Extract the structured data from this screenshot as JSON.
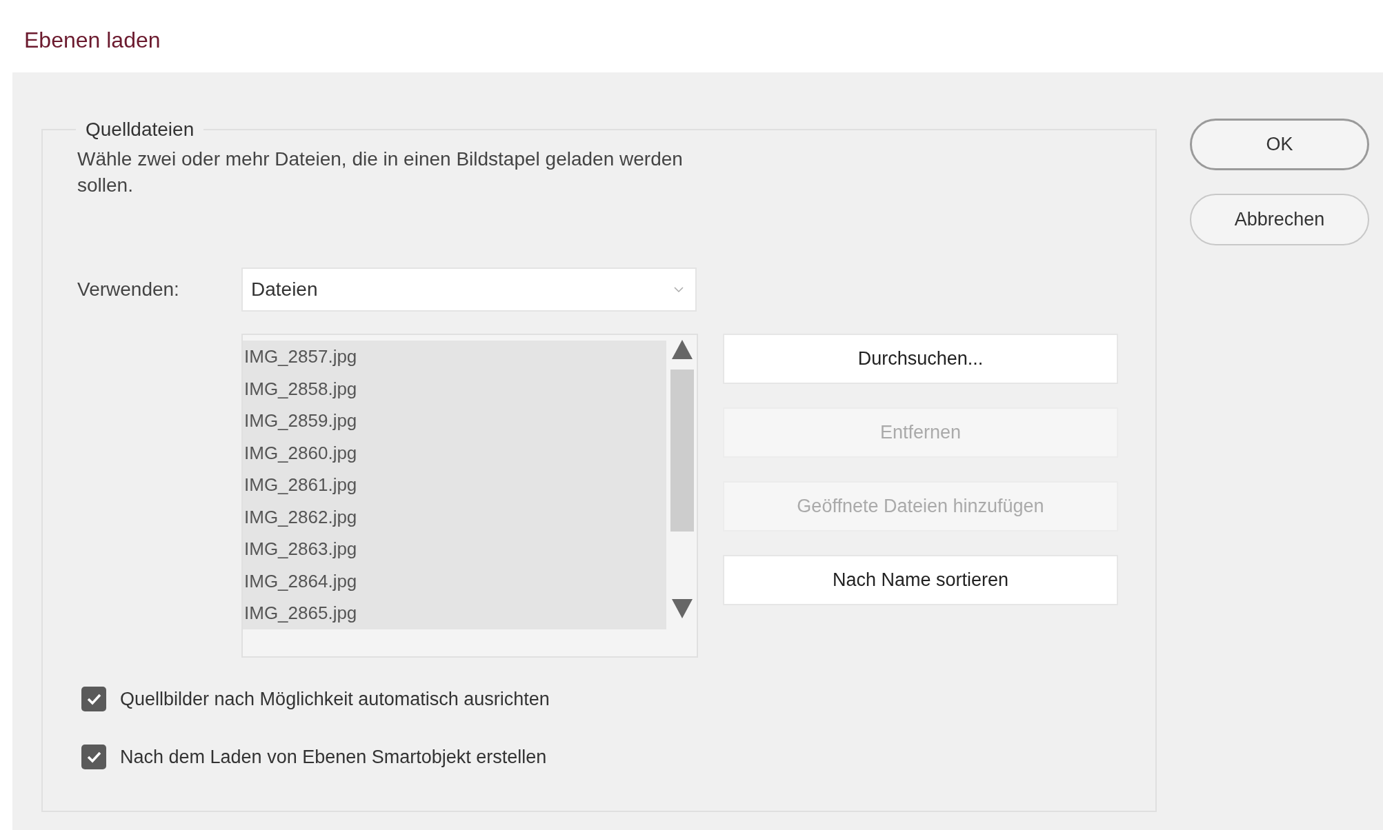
{
  "window": {
    "title": "Ebenen laden"
  },
  "source_files": {
    "legend": "Quelldateien",
    "description": "Wähle zwei oder mehr Dateien, die in einen Bildstapel geladen werden sollen.",
    "use": {
      "label": "Verwenden:",
      "value": "Dateien"
    },
    "files": [
      {
        "name": "IMG_2857.jpg",
        "selected": true
      },
      {
        "name": "IMG_2858.jpg",
        "selected": true
      },
      {
        "name": "IMG_2859.jpg",
        "selected": true
      },
      {
        "name": "IMG_2860.jpg",
        "selected": true
      },
      {
        "name": "IMG_2861.jpg",
        "selected": true
      },
      {
        "name": "IMG_2862.jpg",
        "selected": true
      },
      {
        "name": "IMG_2863.jpg",
        "selected": true
      },
      {
        "name": "IMG_2864.jpg",
        "selected": true
      },
      {
        "name": "IMG_2865.jpg",
        "selected": true
      }
    ],
    "buttons": [
      {
        "label": "Durchsuchen...",
        "disabled": false
      },
      {
        "label": "Entfernen",
        "disabled": true
      },
      {
        "label": "Geöffnete Dateien hinzufügen",
        "disabled": true
      },
      {
        "label": "Nach Name sortieren",
        "disabled": false
      }
    ],
    "options": [
      {
        "label": "Quellbilder nach Möglichkeit automatisch ausrichten",
        "checked": true
      },
      {
        "label": "Nach dem Laden von Ebenen Smartobjekt erstellen",
        "checked": true
      }
    ]
  },
  "dialog_buttons": [
    "OK",
    "Abbrechen"
  ]
}
